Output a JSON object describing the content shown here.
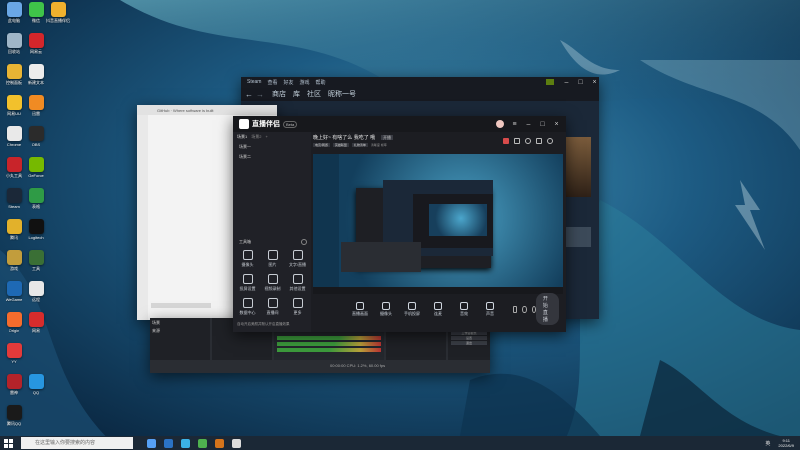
{
  "desktop": {
    "icons": [
      {
        "label": "此电脑",
        "color": "#6aa7e6"
      },
      {
        "label": "微信",
        "color": "#3fc349"
      },
      {
        "label": "抖音直播伴侣",
        "color": "#f0b12e"
      },
      {
        "label": "回收站",
        "color": "#9fb6c8"
      },
      {
        "label": "网易云",
        "color": "#d3262b"
      },
      {
        "label": "",
        "color": ""
      },
      {
        "label": "控制面板",
        "color": "#e8b434"
      },
      {
        "label": "新建文本",
        "color": "#ececec"
      },
      {
        "label": "",
        "color": ""
      },
      {
        "label": "网易UU",
        "color": "#f2c12c"
      },
      {
        "label": "迅雷",
        "color": "#f08b23"
      },
      {
        "label": "",
        "color": ""
      },
      {
        "label": "Chrome",
        "color": "#e9e9e9"
      },
      {
        "label": "OBS",
        "color": "#2b2b2b"
      },
      {
        "label": "",
        "color": ""
      },
      {
        "label": "小丸工具",
        "color": "#c8242a"
      },
      {
        "label": "GeForce",
        "color": "#76b900"
      },
      {
        "label": "",
        "color": ""
      },
      {
        "label": "Steam",
        "color": "#1b2838"
      },
      {
        "label": "表格",
        "color": "#2f9b46"
      },
      {
        "label": "",
        "color": ""
      },
      {
        "label": "腾讯",
        "color": "#e2b12b"
      },
      {
        "label": "Logitech",
        "color": "#111111"
      },
      {
        "label": "",
        "color": ""
      },
      {
        "label": "游戏",
        "color": "#c29d3c"
      },
      {
        "label": "工具",
        "color": "#3a6f35"
      },
      {
        "label": "",
        "color": ""
      },
      {
        "label": "WeGame",
        "color": "#1e69b4"
      },
      {
        "label": "远程",
        "color": "#e7e7e7"
      },
      {
        "label": "",
        "color": ""
      },
      {
        "label": "Origin",
        "color": "#f56c2d"
      },
      {
        "label": "网易",
        "color": "#d72c2c"
      },
      {
        "label": "",
        "color": ""
      },
      {
        "label": "YY",
        "color": "#e33a3a"
      },
      {
        "label": "",
        "color": ""
      },
      {
        "label": "",
        "color": ""
      },
      {
        "label": "雷神",
        "color": "#b3232a"
      },
      {
        "label": "QQ",
        "color": "#2796e0"
      },
      {
        "label": "",
        "color": ""
      },
      {
        "label": "腾讯QQ",
        "color": "#1a1a1a"
      },
      {
        "label": "",
        "color": ""
      },
      {
        "label": "",
        "color": ""
      }
    ]
  },
  "steam": {
    "title_buttons": [
      "Steam",
      "查看",
      "好友",
      "游戏",
      "帮助"
    ],
    "nav": [
      "商店",
      "库",
      "社区",
      "昵称一号"
    ],
    "back_arrow": "←",
    "forward_arrow": "→"
  },
  "live": {
    "logo": "直播伴侣",
    "logo_badge": "Beta",
    "title": "晚上好~ 有啥了么 我吃了 哦",
    "tag": "开播",
    "subtitle_tags": [
      "电竞/网游",
      "英雄联盟",
      "礼物清单"
    ],
    "subtitle_meta": "清晰度  帧率",
    "tabs": [
      "场景1",
      "场景2",
      "+"
    ],
    "scene_items": [
      "场景一",
      "场景二"
    ],
    "panel_title": "工具箱",
    "tools": [
      {
        "label": "摄像头"
      },
      {
        "label": "图片"
      },
      {
        "label": "文字/直播"
      },
      {
        "label": "投屏设置"
      },
      {
        "label": "视频录制"
      },
      {
        "label": "其他设置"
      },
      {
        "label": "数据中心"
      },
      {
        "label": "直播间"
      },
      {
        "label": "更多"
      }
    ],
    "bottom_buttons": [
      {
        "label": "直播画面"
      },
      {
        "label": "摄像头"
      },
      {
        "label": "手机投屏"
      },
      {
        "label": "连麦"
      },
      {
        "label": "音效"
      },
      {
        "label": "声音"
      }
    ],
    "start_button": "开始直播",
    "footer_checkbox": "自动开启美颜并默认开启直播效果"
  },
  "obs": {
    "scenes_header": "场景",
    "sources_header": "来源",
    "audio_header": "混音器",
    "controls": [
      "开始推流",
      "开始录制",
      "工作室模式",
      "设置",
      "退出"
    ],
    "counters": "00:00:00  CPU: 1.2%, 60.00 fps"
  },
  "browser": {
    "title": "GitHub · Where software is built"
  },
  "taskbar": {
    "search_placeholder": "在这里输入你要搜索的内容",
    "time": "9:11",
    "date": "2022/6/9",
    "lang": "英",
    "pinned_colors": [
      "#56a0f5",
      "#2b72c4",
      "#3bb3e7",
      "#4fb24f",
      "#d6741b",
      "#ddd"
    ]
  }
}
